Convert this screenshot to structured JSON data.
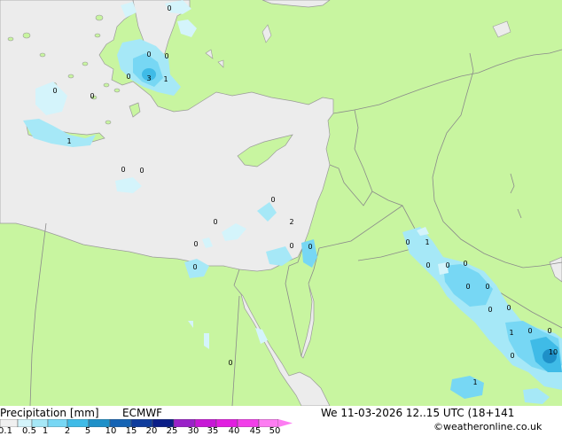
{
  "footer": {
    "title": "Precipitation [mm]",
    "model": "ECMWF",
    "valid_time": "We 11-03-2026 12..15 UTC (18+141",
    "credit": "©weatheronline.co.uk"
  },
  "legend": {
    "ticks": [
      "0.1",
      "0.5",
      "1",
      "2",
      "5",
      "10",
      "15",
      "20",
      "25",
      "30",
      "35",
      "40",
      "45",
      "50"
    ],
    "colors": [
      "#f0f0f0",
      "#d4f4fb",
      "#a6e8f7",
      "#77d7f4",
      "#3fbbe7",
      "#1e90c8",
      "#1463b4",
      "#0e3c9c",
      "#0a1e87",
      "#9a22c8",
      "#c718d6",
      "#e11ee0",
      "#f23ee9",
      "#fd7df2"
    ]
  },
  "colors": {
    "land": "#c8f5a0",
    "sea": "#ececec",
    "border": "#8a8a8a",
    "coast": "#9a9a9a"
  },
  "map": {
    "value_labels": [
      "0",
      "0",
      "0",
      "3",
      "1",
      "0",
      "0",
      "1",
      "0",
      "0",
      "0",
      "0",
      "0",
      "0",
      "2",
      "0",
      "0",
      "0",
      "0",
      "1",
      "0",
      "0",
      "0",
      "0",
      "0",
      "0",
      "0",
      "1",
      "0",
      "10",
      "0",
      "1",
      "0",
      "0"
    ]
  }
}
